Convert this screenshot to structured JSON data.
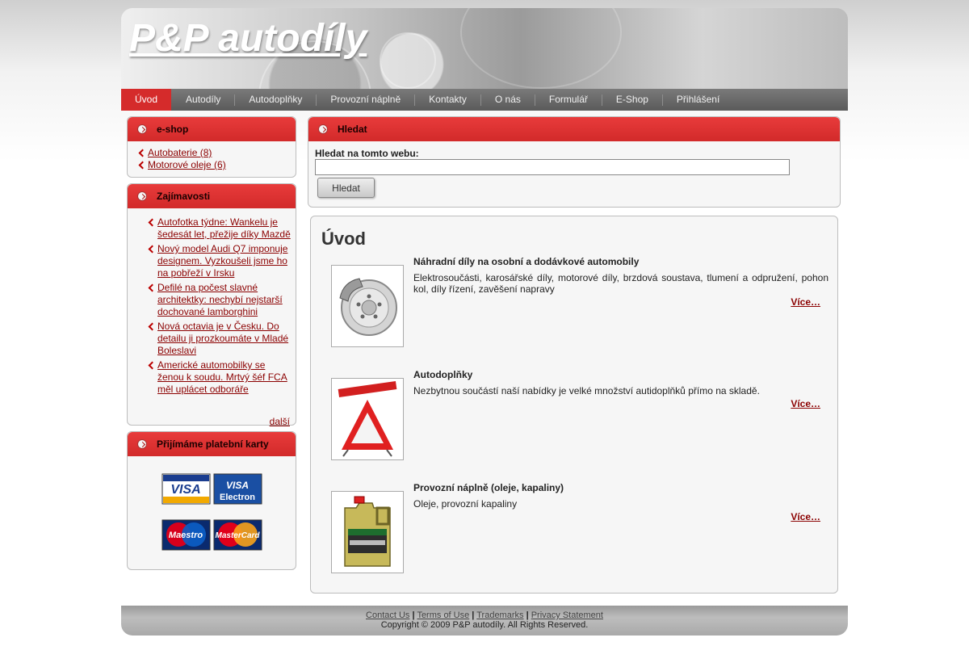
{
  "site": {
    "title": "P&P autodíly"
  },
  "nav": {
    "items": [
      {
        "label": "Úvod",
        "active": true
      },
      {
        "label": "Autodíly"
      },
      {
        "label": "Autodoplňky"
      },
      {
        "label": "Provozní náplně"
      },
      {
        "label": "Kontakty"
      },
      {
        "label": "O nás"
      },
      {
        "label": "Formulář"
      },
      {
        "label": "E-Shop"
      },
      {
        "label": "Přihlášení"
      }
    ]
  },
  "eshop": {
    "title": "e-shop",
    "items": [
      "Autobaterie (8)",
      "Motorové oleje (6)"
    ]
  },
  "news": {
    "title": "Zajímavosti",
    "items": [
      "Autofotka týdne: Wankelu je šedesát let, přežije díky Mazdě",
      "Nový model Audi Q7 imponuje designem. Vyzkoušeli jsme ho na pobřeží v Irsku",
      "Defilé na počest slavné architektky: nechybí nejstarší dochované lamborghini",
      "Nová octavia je v Česku. Do detailu ji prozkoumáte v Mladé Boleslavi",
      "Americké automobilky se ženou k soudu. Mrtvý šéf FCA měl uplácet odboráře"
    ],
    "more": "další"
  },
  "cards": {
    "title": "Přijímáme platební karty",
    "logos": [
      "VISA",
      "VISA Electron",
      "Maestro",
      "MasterCard"
    ]
  },
  "search": {
    "title": "Hledat",
    "label": "Hledat na tomto webu:",
    "value": "",
    "button": "Hledat"
  },
  "main": {
    "title": "Úvod",
    "products": [
      {
        "title": "Náhradní díly na osobní a dodávkové automobily",
        "desc": "Elektrosoučásti, karosářské díly, motorové díly, brzdová soustava, tlumení a odpružení, pohon kol, díly řízení, zavěšení napravy",
        "more": "Více…",
        "image": "brake-disc"
      },
      {
        "title": "Autodoplňky",
        "desc": "Nezbytnou součástí naší nabídky je velké množství autidoplňků přímo na skladě.",
        "more": "Více…",
        "image": "warning-triangle"
      },
      {
        "title": "Provozní náplně (oleje, kapaliny)",
        "desc": "Oleje, provozní kapaliny",
        "more": "Více…",
        "image": "oil-canister"
      }
    ]
  },
  "footer": {
    "links": [
      "Contact Us",
      "Terms of Use",
      "Trademarks",
      "Privacy Statement"
    ],
    "separator": "|",
    "copyright": "Copyright © 2009 P&P autodíly. All Rights Reserved."
  }
}
